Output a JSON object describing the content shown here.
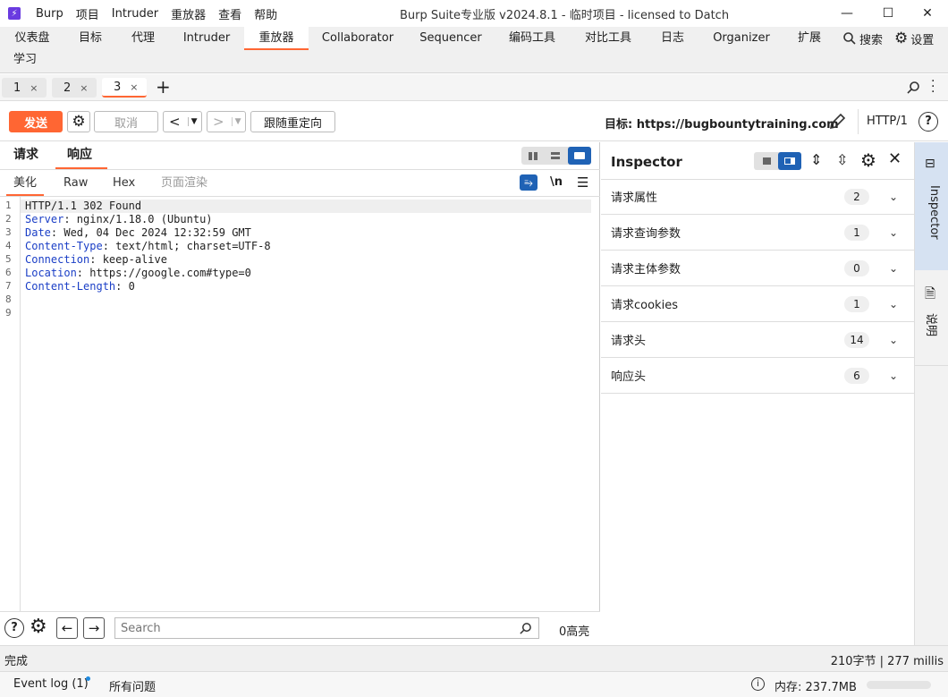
{
  "window": {
    "menu": [
      "Burp",
      "项目",
      "Intruder",
      "重放器",
      "查看",
      "帮助"
    ],
    "title": "Burp Suite专业版  v2024.8.1 - 临时项目 - licensed to Datch",
    "min": "—",
    "max": "☐",
    "close": "✕"
  },
  "tool_tabs": [
    "仪表盘",
    "目标",
    "代理",
    "Intruder",
    "重放器",
    "Collaborator",
    "Sequencer",
    "编码工具",
    "对比工具",
    "日志",
    "Organizer",
    "扩展",
    "学习"
  ],
  "search_label": "搜索",
  "settings_label": "设置",
  "repeater_tabs": [
    {
      "label": "1",
      "close": "×"
    },
    {
      "label": "2",
      "close": "×"
    },
    {
      "label": "3",
      "close": "×"
    }
  ],
  "add_tab": "+",
  "toolbar": {
    "send": "发送",
    "cancel": "取消",
    "back": "<",
    "forward": ">",
    "follow_redirect": "跟随重定向",
    "target_label": "目标: https://bugbountytraining.com",
    "protocol": "HTTP/1"
  },
  "pane_tabs": {
    "request": "请求",
    "response": "响应"
  },
  "view_tabs": {
    "pretty": "美化",
    "raw": "Raw",
    "hex": "Hex",
    "render": "页面渲染"
  },
  "newline_toggle": "\\n",
  "response_lines": [
    {
      "n": "1",
      "name": "",
      "value": "HTTP/1.1 302 Found"
    },
    {
      "n": "2",
      "name": "Server",
      "value": ": nginx/1.18.0 (Ubuntu)"
    },
    {
      "n": "3",
      "name": "Date",
      "value": ": Wed, 04 Dec 2024 12:32:59 GMT"
    },
    {
      "n": "4",
      "name": "Content-Type",
      "value": ": text/html; charset=UTF-8"
    },
    {
      "n": "5",
      "name": "Connection",
      "value": ": keep-alive"
    },
    {
      "n": "6",
      "name": "Location",
      "value": ": https://google.com#type=0"
    },
    {
      "n": "7",
      "name": "Content-Length",
      "value": ": 0"
    },
    {
      "n": "8",
      "name": "",
      "value": ""
    },
    {
      "n": "9",
      "name": "",
      "value": ""
    }
  ],
  "bottom_search": {
    "placeholder": "Search",
    "highlights": "0高亮"
  },
  "inspector": {
    "title": "Inspector",
    "rows": [
      {
        "label": "请求属性",
        "count": "2"
      },
      {
        "label": "请求查询参数",
        "count": "1"
      },
      {
        "label": "请求主体参数",
        "count": "0"
      },
      {
        "label": "请求cookies",
        "count": "1"
      },
      {
        "label": "请求头",
        "count": "14"
      },
      {
        "label": "响应头",
        "count": "6"
      }
    ]
  },
  "side_tabs": {
    "inspector": "Inspector",
    "notes": "说明"
  },
  "status": {
    "left": "完成",
    "right": "210字节 | 277 millis"
  },
  "footer": {
    "event_log": "Event log (1)",
    "issues": "所有问题",
    "memory": "内存: 237.7MB"
  },
  "colors": {
    "accent": "#ff6633",
    "header_name": "#1a3ec6",
    "toggle_blue": "#1f62b5"
  }
}
